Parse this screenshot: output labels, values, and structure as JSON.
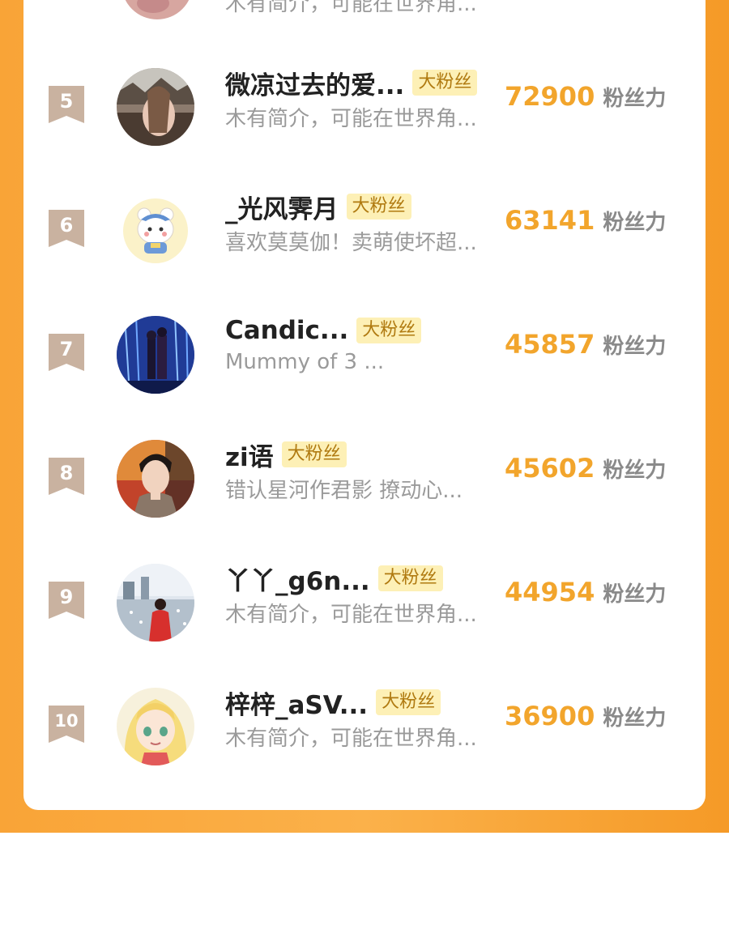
{
  "partial_top": {
    "bio": "木有简介，可能在世界角..."
  },
  "unit_label": "粉丝力",
  "tag_label": "大粉丝",
  "rows": [
    {
      "rank": "5",
      "name": "微凉过去的爱...",
      "tag": "大粉丝",
      "bio": "木有简介，可能在世界角...",
      "score": "72900",
      "unit": "粉丝力"
    },
    {
      "rank": "6",
      "name": "_光风霁月",
      "tag": "大粉丝",
      "bio": "喜欢莫莫伽！卖萌使坏超...",
      "score": "63141",
      "unit": "粉丝力"
    },
    {
      "rank": "7",
      "name": "Candic...",
      "tag": "大粉丝",
      "bio": "Mummy of 3 ...",
      "score": "45857",
      "unit": "粉丝力"
    },
    {
      "rank": "8",
      "name": "zi语",
      "tag": "大粉丝",
      "bio": "错认星河作君影 撩动心...",
      "score": "45602",
      "unit": "粉丝力"
    },
    {
      "rank": "9",
      "name": "丫丫_g6n...",
      "tag": "大粉丝",
      "bio": "木有简介，可能在世界角...",
      "score": "44954",
      "unit": "粉丝力"
    },
    {
      "rank": "10",
      "name": "梓梓_aSV...",
      "tag": "大粉丝",
      "bio": "木有简介，可能在世界角...",
      "score": "36900",
      "unit": "粉丝力"
    }
  ],
  "colors": {
    "accent_orange": "#f9a437",
    "score_gold": "#f2a52c",
    "rank_badge": "#c9b2a0",
    "tag_bg": "#fdf0b6",
    "tag_text": "#b07a10"
  }
}
